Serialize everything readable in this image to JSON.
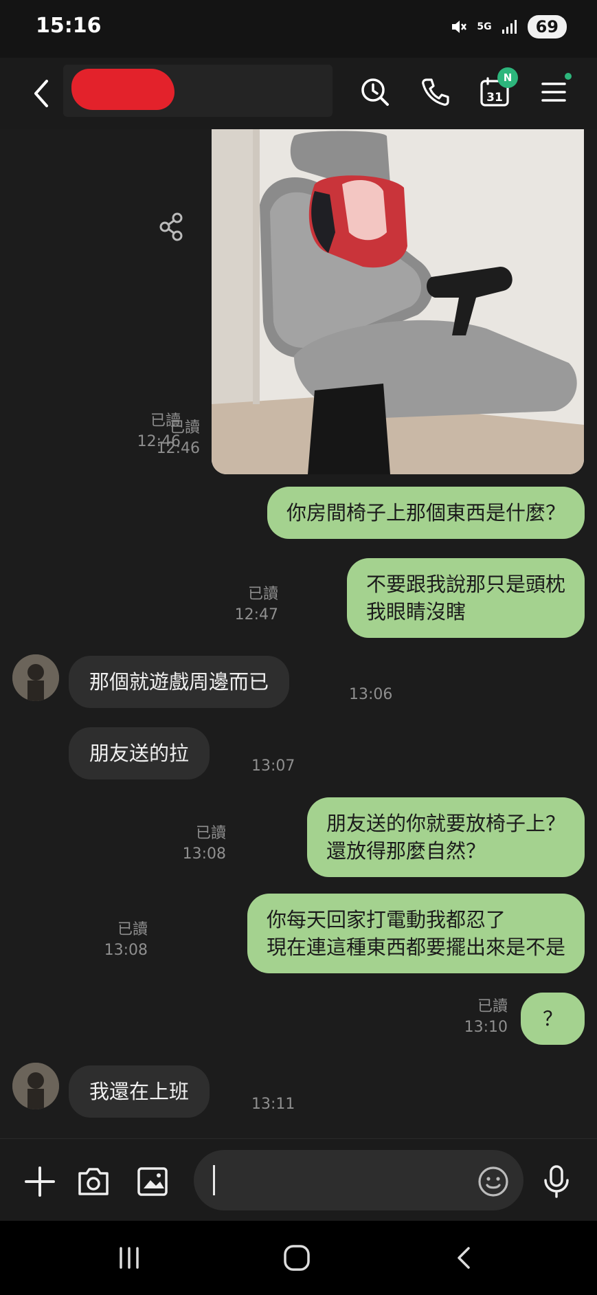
{
  "status": {
    "time": "15:16",
    "network": "5G",
    "battery": "69"
  },
  "header": {
    "icons": [
      "back-arrow-icon",
      "clock-search-icon",
      "phone-icon",
      "calendar-icon",
      "menu-icon"
    ],
    "calendar_day": "31",
    "calendar_badge": "N",
    "accent_color": "#2db67c"
  },
  "messages": [
    {
      "id": "m0",
      "direction": "outgoing",
      "type": "image",
      "read": "已讀",
      "time": "12:46"
    },
    {
      "id": "m1",
      "direction": "outgoing",
      "read": "已讀",
      "time": "12:46",
      "lines": [
        "你房間椅子上那個東西是什麼？"
      ]
    },
    {
      "id": "m2",
      "direction": "outgoing",
      "read": "已讀",
      "time": "12:47",
      "lines": [
        "不要跟我說那只是頭枕",
        "我眼睛沒瞎"
      ]
    },
    {
      "id": "m3",
      "direction": "incoming",
      "time": "13:06",
      "lines": [
        "那個就遊戲周邊而已"
      ]
    },
    {
      "id": "m4",
      "direction": "incoming",
      "time": "13:07",
      "lines": [
        "朋友送的拉"
      ]
    },
    {
      "id": "m5",
      "direction": "outgoing",
      "read": "已讀",
      "time": "13:08",
      "lines": [
        "朋友送的你就要放椅子上？",
        "還放得那麼自然？"
      ]
    },
    {
      "id": "m6",
      "direction": "outgoing",
      "read": "已讀",
      "time": "13:08",
      "lines": [
        "你每天回家打電動我都忍了",
        "現在連這種東西都要擺出來是不是"
      ]
    },
    {
      "id": "m7",
      "direction": "outgoing",
      "read": "已讀",
      "time": "13:10",
      "lines": [
        "？"
      ]
    },
    {
      "id": "m8",
      "direction": "incoming",
      "time": "13:11",
      "lines": [
        "我還在上班"
      ]
    }
  ],
  "input": {
    "placeholder": ""
  },
  "colors": {
    "outgoing_bubble": "#a4d28f",
    "incoming_bubble": "#2e2e2e",
    "background": "#1c1c1c"
  }
}
